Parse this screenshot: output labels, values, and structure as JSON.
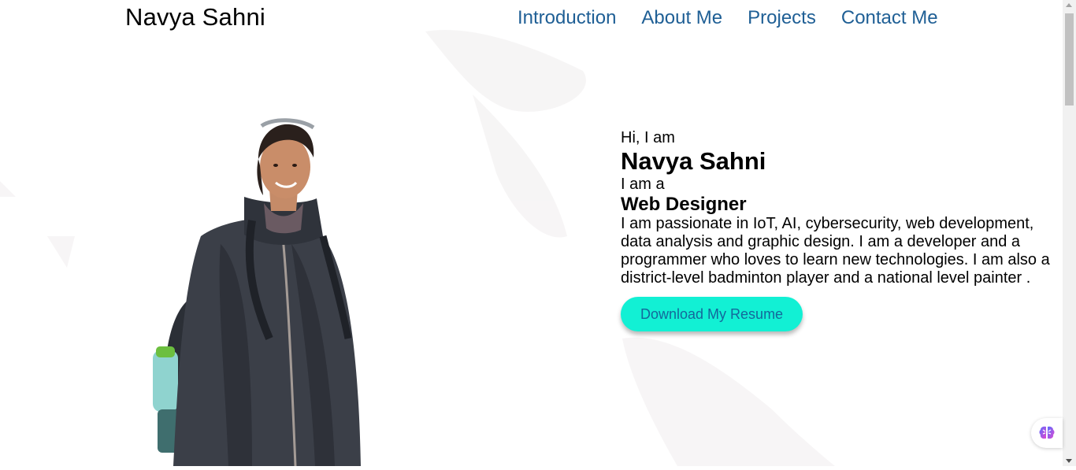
{
  "header": {
    "brand": "Navya Sahni",
    "nav": [
      "Introduction",
      "About Me",
      "Projects",
      "Contact Me"
    ]
  },
  "hero": {
    "greeting": "Hi, I am",
    "name": "Navya Sahni",
    "iam": "I am a",
    "role": "Web Designer",
    "bio": "I am passionate in IoT, AI, cybersecurity, web development, data analysis and graphic design. I am a developer and a programmer who loves to learn new technologies. I am also a district-level badminton player and a national level painter .",
    "cta": "Download My Resume"
  },
  "colors": {
    "nav_link": "#1f5f95",
    "cta_bg": "#12f0d4",
    "cta_text": "#14689b"
  },
  "icons": {
    "floating_widget": "brain-icon"
  }
}
